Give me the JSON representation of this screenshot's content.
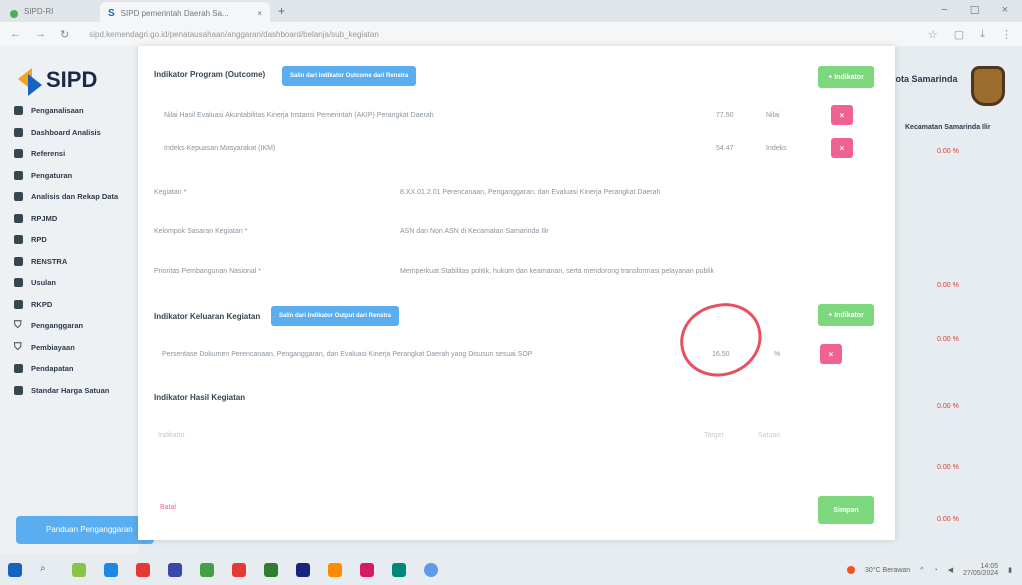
{
  "browser": {
    "tab_inactive_label": "SIPD-RI",
    "tab_active_label": "SIPD pemerintah Daerah Sa...",
    "tab_close": "×",
    "new_tab": "+",
    "url": "sipd.kemendagri.go.id/penatausahaan/anggaran/dashboard/belanja/sub_kegiatan",
    "window_controls": [
      "−",
      "☐",
      "×"
    ]
  },
  "sidebar": {
    "logo": "SIPD",
    "items": [
      {
        "label": "Penganalisaan",
        "icon": "card-icon"
      },
      {
        "label": "Dashboard Analisis",
        "icon": "dashboard-icon"
      },
      {
        "label": "Referensi",
        "icon": "book-icon"
      },
      {
        "label": "Pengaturan",
        "icon": "gear-icon"
      },
      {
        "label": "Analisis dan Rekap Data",
        "icon": "chart-icon"
      },
      {
        "label": "RPJMD",
        "icon": "document-icon"
      },
      {
        "label": "RPD",
        "icon": "document-icon"
      },
      {
        "label": "RENSTRA",
        "icon": "grid-icon"
      },
      {
        "label": "Usulan",
        "icon": "grid-icon"
      },
      {
        "label": "RKPD",
        "icon": "bar-icon"
      },
      {
        "label": "Penganggaran",
        "icon": "cart-icon"
      },
      {
        "label": "Pembiayaan",
        "icon": "cart-icon"
      },
      {
        "label": "Pendapatan",
        "icon": "money-icon"
      },
      {
        "label": "Standar Harga Satuan",
        "icon": "tag-icon"
      }
    ],
    "panduan_label": "Panduan Penganggaran"
  },
  "background": {
    "city": "Kota Samarinda",
    "column_header": "Kecamatan Samarinda Ilir",
    "percentages": [
      "0.00 %",
      "0.00 %",
      "0.00 %",
      "0.00 %",
      "0.00 %",
      "0.00 %"
    ]
  },
  "modal": {
    "program_outcome": {
      "title": "Indikator Program (Outcome)",
      "chip": "Salin dari Indikator Outcome dari Renstra",
      "add_button": "+ Indikator",
      "rows": [
        {
          "text": "Nilai Hasil Evaluasi Akuntabilitas Kinerja Instansi Pemerintah (AKIP) Perangkat Daerah",
          "value": "77.50",
          "unit": "Nilai",
          "delete": "×"
        },
        {
          "text": "Indeks Kepuasan Masyarakat (IKM)",
          "value": "54.47",
          "unit": "Indeks",
          "delete": "×"
        }
      ]
    },
    "kegiatan": {
      "label": "Kegiatan *",
      "value": "8.XX.01.2.01 Perencanaan, Penganggaran, dan Evaluasi Kinerja Perangkat Daerah"
    },
    "sasaran": {
      "label": "Kelompok Sasaran Kegiatan *",
      "value": "ASN dan Non ASN di Kecamatan Samarinda Ilir"
    },
    "prioritas": {
      "label": "Prioritas Pembangunan Nasional *",
      "value": "Memperkuat Stabilitas politik, hukum dan keamanan, serta mendorong transformasi pelayanan publik"
    },
    "keluaran": {
      "title": "Indikator Keluaran Kegiatan",
      "chip": "Salin dari Indikator Output dari Renstra",
      "add_button": "+ Indikator",
      "row": {
        "text": "Persentase Dokumen Perencanaan, Penganggaran, dan Evaluasi Kinerja Perangkat Daerah yang Disusun sesuai SOP",
        "value": "16.50",
        "unit": "%",
        "delete": "×"
      }
    },
    "hasil": {
      "title": "Indikator Hasil Kegiatan",
      "placeholder": "Indikator",
      "target_placeholder": "Target",
      "unit_placeholder": "Satuan"
    },
    "cancel_label": "Batal",
    "save_label": "Simpan"
  },
  "taskbar": {
    "weather": "30°C Berawan",
    "time": "14:05",
    "date": "27/05/2024"
  }
}
